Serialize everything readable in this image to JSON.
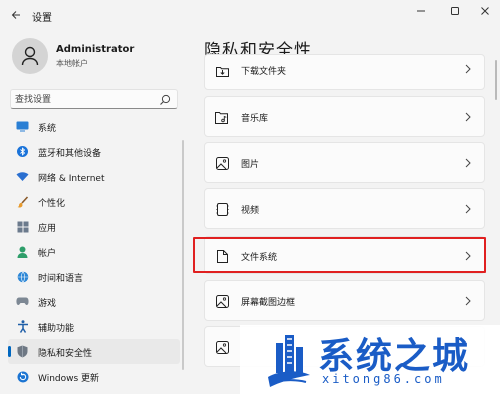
{
  "window": {
    "title": "设置"
  },
  "user": {
    "name": "Administrator",
    "type": "本地帐户"
  },
  "search": {
    "placeholder": "查找设置"
  },
  "sidebar": {
    "items": [
      {
        "label": "系统",
        "icon": "monitor-icon",
        "active": false
      },
      {
        "label": "蓝牙和其他设备",
        "icon": "bluetooth-icon",
        "active": false
      },
      {
        "label": "网络 & Internet",
        "icon": "wifi-icon",
        "active": false
      },
      {
        "label": "个性化",
        "icon": "brush-icon",
        "active": false
      },
      {
        "label": "应用",
        "icon": "apps-icon",
        "active": false
      },
      {
        "label": "帐户",
        "icon": "person-icon",
        "active": false
      },
      {
        "label": "时间和语言",
        "icon": "globe-clock-icon",
        "active": false
      },
      {
        "label": "游戏",
        "icon": "gamepad-icon",
        "active": false
      },
      {
        "label": "辅助功能",
        "icon": "accessibility-icon",
        "active": false
      },
      {
        "label": "隐私和安全性",
        "icon": "shield-icon",
        "active": true
      },
      {
        "label": "Windows 更新",
        "icon": "update-icon",
        "active": false
      }
    ]
  },
  "main": {
    "title": "隐私和安全性",
    "items": [
      {
        "label": "下载文件夹",
        "icon": "download-folder-icon"
      },
      {
        "label": "音乐库",
        "icon": "music-folder-icon"
      },
      {
        "label": "图片",
        "icon": "picture-icon"
      },
      {
        "label": "视频",
        "icon": "video-icon"
      },
      {
        "label": "文件系统",
        "icon": "file-icon"
      },
      {
        "label": "屏幕截图边框",
        "icon": "screenshot-icon"
      },
      {
        "label": "",
        "icon": "image-icon"
      }
    ]
  },
  "watermark": {
    "title": "系统之城",
    "url": "xitong86.com"
  },
  "colors": {
    "accent": "#0067c0",
    "highlight": "#e02020",
    "watermark": "#1a5cc6"
  }
}
